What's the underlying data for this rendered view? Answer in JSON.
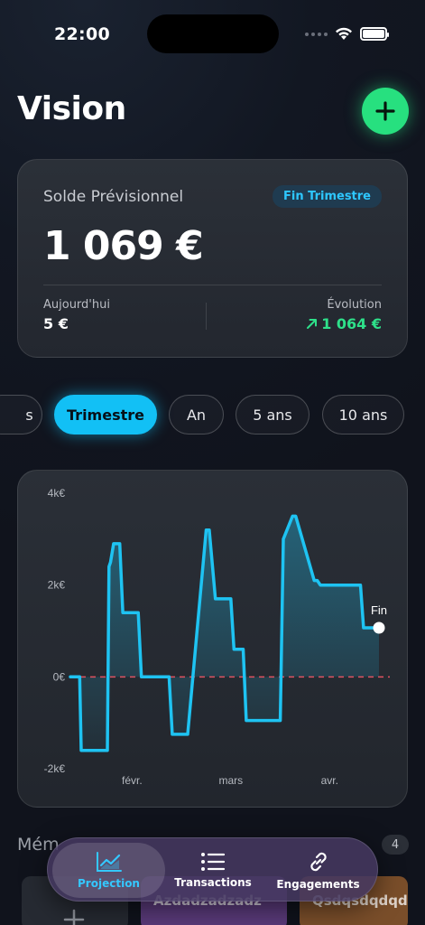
{
  "status_bar": {
    "time": "22:00"
  },
  "header": {
    "title": "Vision"
  },
  "balance_card": {
    "label": "Solde Prévisionnel",
    "badge": "Fin Trimestre",
    "amount": "1 069 €",
    "today_label": "Aujourd'hui",
    "today_value": "5 €",
    "evolution_label": "Évolution",
    "evolution_value": "1 064 €"
  },
  "period_filters": [
    {
      "label": "s",
      "selected": false
    },
    {
      "label": "Trimestre",
      "selected": true
    },
    {
      "label": "An",
      "selected": false
    },
    {
      "label": "5 ans",
      "selected": false
    },
    {
      "label": "10 ans",
      "selected": false
    }
  ],
  "chart_data": {
    "type": "area",
    "y_ticks": [
      "4k€",
      "2k€",
      "0€",
      "-2k€"
    ],
    "x_ticks": [
      "févr.",
      "mars",
      "avr."
    ],
    "ylim": [
      -2000,
      4000
    ],
    "end_label": "Fin",
    "reference_line": 0,
    "series": [
      {
        "x": [
          0,
          0.01,
          0.03,
          0.035,
          0.05,
          0.06,
          0.12,
          0.125,
          0.13,
          0.14,
          0.15,
          0.16,
          0.17,
          0.21,
          0.22,
          0.23,
          0.32,
          0.33,
          0.35,
          0.36,
          0.38,
          0.44,
          0.45,
          0.47,
          0.48,
          0.49,
          0.52,
          0.53,
          0.56,
          0.57,
          0.68,
          0.69,
          0.72,
          0.73,
          0.79,
          0.8,
          0.81,
          0.82,
          0.83,
          0.84,
          0.91,
          0.92,
          0.94,
          0.95,
          1.0
        ],
        "y": [
          0,
          0,
          0,
          -1600,
          -1600,
          -1600,
          -1600,
          2400,
          2500,
          2900,
          2900,
          2900,
          1400,
          1400,
          1400,
          0,
          0,
          -1250,
          -1250,
          -1250,
          -1250,
          3200,
          3200,
          1700,
          1700,
          1700,
          1700,
          600,
          600,
          -950,
          -950,
          3000,
          3500,
          3500,
          2100,
          2100,
          2000,
          2000,
          2000,
          2000,
          2000,
          2000,
          2000,
          1069,
          1069
        ]
      }
    ]
  },
  "memos": {
    "title": "Mém",
    "count": "4",
    "tiles": [
      {
        "text": ""
      },
      {
        "text": "Azdadzadzadz"
      },
      {
        "text": "Qsdqsdqdqd"
      }
    ]
  },
  "tab_bar": {
    "tabs": [
      {
        "label": "Projection",
        "active": true
      },
      {
        "label": "Transactions",
        "active": false
      },
      {
        "label": "Engagements",
        "active": false
      }
    ]
  },
  "colors": {
    "accent_green": "#27e07f",
    "accent_cyan": "#12c0f5",
    "chart_line": "#1ec3f2",
    "zero_line": "#e05260",
    "positive_text": "#2ee08a"
  }
}
